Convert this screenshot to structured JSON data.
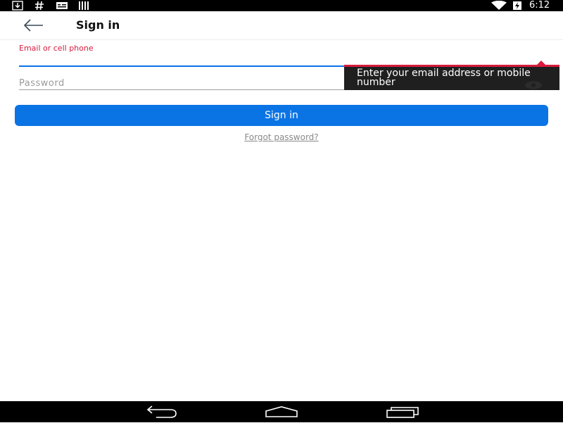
{
  "status_bar": {
    "time": "6:12",
    "icons": [
      "download-icon",
      "hash-icon",
      "message-icon",
      "barcode-icon",
      "wifi-icon",
      "battery-charging-icon"
    ]
  },
  "app_bar": {
    "title": "Sign in",
    "back_icon": "arrow-left-icon"
  },
  "form": {
    "email": {
      "label": "Email or cell phone",
      "value": "",
      "error_tooltip": "Enter your email address or mobile number"
    },
    "password": {
      "placeholder": "Password",
      "value": "",
      "toggle_icon": "eye-icon"
    },
    "submit_label": "Sign in",
    "forgot_label": "Forgot password?"
  },
  "nav_bar": {
    "buttons": [
      "back-icon",
      "home-icon",
      "recents-icon"
    ]
  },
  "colors": {
    "accent_blue": "#0b74e5",
    "error_red": "#d81b3c",
    "tooltip_bg": "#1f1f1f",
    "link_gray": "#8a8a8a"
  }
}
